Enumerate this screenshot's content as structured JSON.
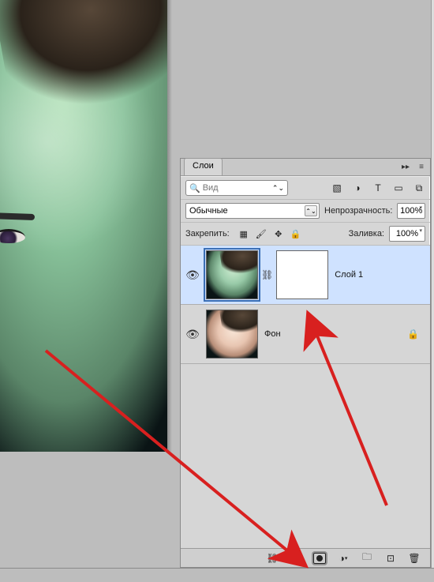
{
  "panel": {
    "tab_label": "Слои",
    "search": {
      "placeholder": "Вид",
      "value": ""
    },
    "blend_mode": "Обычные",
    "opacity_label": "Непрозрачность:",
    "opacity_value": "100%",
    "lock_label": "Закрепить:",
    "fill_label": "Заливка:",
    "fill_value": "100%",
    "layers": [
      {
        "name": "Слой 1"
      },
      {
        "name": "Фон"
      }
    ],
    "footer_fx": "fx"
  }
}
